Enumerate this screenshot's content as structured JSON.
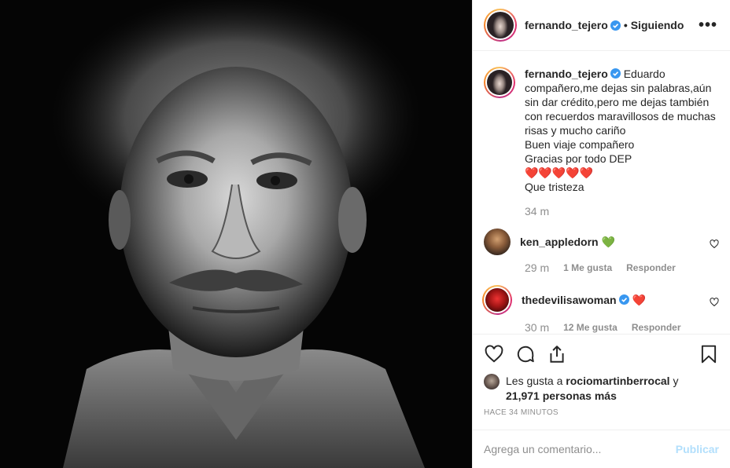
{
  "post": {
    "author": "fernando_tejero",
    "follow_status": "Siguiendo",
    "more_label": "•••",
    "caption_lines": [
      "Eduardo",
      "compañero,me dejas sin palabras,aún",
      "sin dar crédito,pero me dejas también",
      "con recuerdos maravillosos de muchas",
      "risas y mucho cariño",
      "Buen viaje compañero",
      "Gracias por todo DEP",
      "❤️❤️❤️❤️❤️",
      "Que tristeza"
    ],
    "caption_time": "34 m"
  },
  "comments": [
    {
      "user": "ken_appledorn",
      "text": "💚",
      "time": "29 m",
      "likes": "1 Me gusta",
      "reply": "Responder",
      "verified": false
    },
    {
      "user": "thedevilisawoman",
      "text": "❤️",
      "time": "30 m",
      "likes": "12 Me gusta",
      "reply": "Responder",
      "verified": true
    }
  ],
  "likes": {
    "prefix": "Les gusta a",
    "user": "rociomartinberrocal",
    "and": "y",
    "count": "21,971 personas más"
  },
  "timestamp": "HACE 34 MINUTOS",
  "add_comment": {
    "placeholder": "Agrega un comentario...",
    "post_label": "Publicar"
  },
  "icons": {
    "like": "heart-icon",
    "comment": "comment-icon",
    "share": "share-icon",
    "save": "bookmark-icon",
    "verified_color": "#3897f0"
  }
}
